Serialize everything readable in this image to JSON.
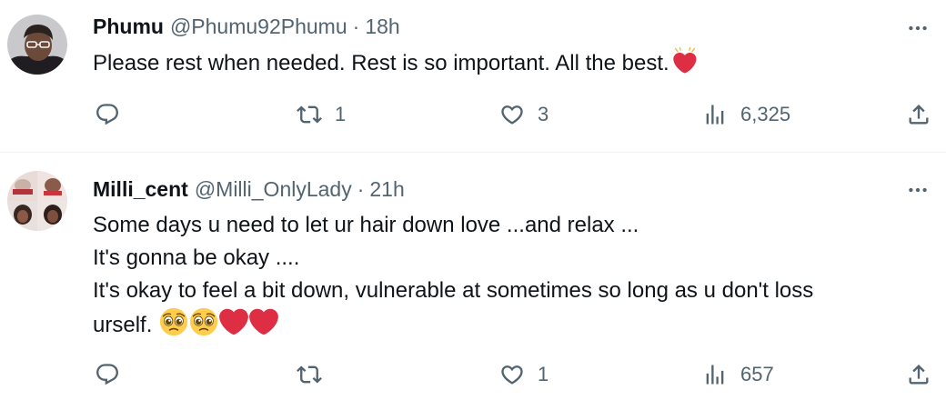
{
  "tweets": [
    {
      "display_name": "Phumu",
      "handle": "@Phumu92Phumu",
      "separator": "·",
      "time": "18h",
      "text_lines": [
        "Please rest when needed. Rest is so important. All the best."
      ],
      "emojis": [
        "growing-heart"
      ],
      "replies": "",
      "reposts": "1",
      "likes": "3",
      "views": "6,325"
    },
    {
      "display_name": "Milli_cent",
      "handle": "@Milli_OnlyLady",
      "separator": "·",
      "time": "21h",
      "text_lines": [
        "Some days u need to let ur hair down love ...and relax ...",
        "It's gonna be okay ....",
        "It's okay to feel a bit down, vulnerable at sometimes so long as u don't loss",
        "urself."
      ],
      "emojis": [
        "pleading-face",
        "pleading-face",
        "red-heart",
        "red-heart"
      ],
      "replies": "",
      "reposts": "",
      "likes": "1",
      "views": "657"
    }
  ],
  "colors": {
    "text": "#0f1419",
    "secondary": "#536471",
    "divider": "#eff3f4",
    "heart_red": "#dd2e44",
    "emoji_yellow": "#ffcc4d"
  },
  "icons": [
    "reply-icon",
    "repost-icon",
    "like-icon",
    "views-icon",
    "share-icon",
    "more-icon"
  ]
}
